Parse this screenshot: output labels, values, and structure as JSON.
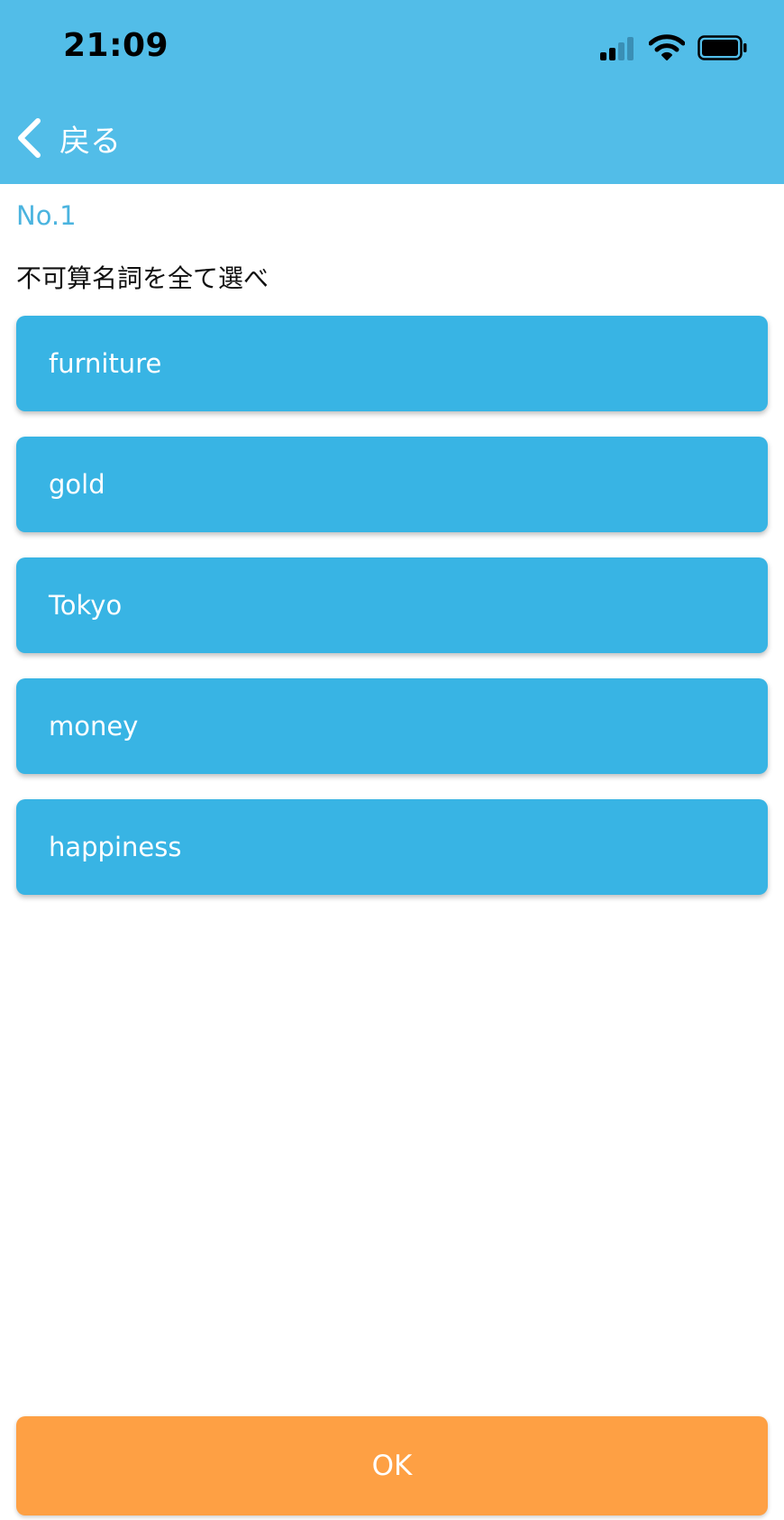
{
  "status_bar": {
    "time": "21:09"
  },
  "nav": {
    "back_label": "戻る"
  },
  "question": {
    "number": "No.1",
    "text": "不可算名詞を全て選べ"
  },
  "choices": [
    {
      "label": "furniture"
    },
    {
      "label": "gold"
    },
    {
      "label": "Tokyo"
    },
    {
      "label": "money"
    },
    {
      "label": "happiness"
    }
  ],
  "ok_button": {
    "label": "OK"
  },
  "colors": {
    "header": "#52bde8",
    "choice": "#38b4e4",
    "ok": "#fea044",
    "accent_text": "#4bb4df"
  },
  "icons": {
    "back": "chevron-left-icon",
    "signal": "cellular-signal-icon",
    "wifi": "wifi-icon",
    "battery": "battery-icon"
  }
}
